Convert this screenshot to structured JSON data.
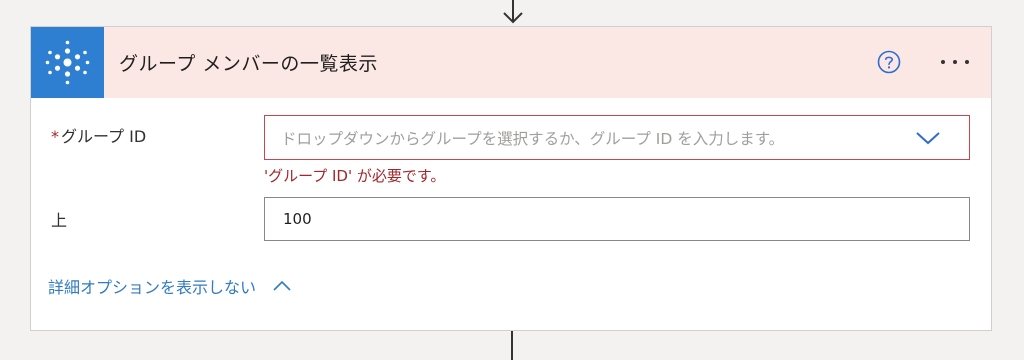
{
  "card": {
    "title": "グループ メンバーの一覧表示",
    "icon": "office365-groups-icon",
    "header_color": "#fbe8e4",
    "icon_bg_color": "#2e7fd1"
  },
  "fields": {
    "group_id": {
      "required_marker": "*",
      "label": "グループ ID",
      "placeholder": "ドロップダウンからグループを選択するか、グループ ID を入力します。",
      "error": "'グループ ID' が必要です。",
      "error_color": "#a4262c"
    },
    "top": {
      "label": "上",
      "value": "100"
    }
  },
  "advanced_options": {
    "label": "詳細オプションを表示しない",
    "link_color": "#2f7bc4"
  },
  "icons": {
    "help": "help-circle-icon",
    "more": "more-horizontal-icon",
    "arrow": "arrow-down-icon",
    "dropdown": "chevron-down-icon",
    "collapse": "chevron-up-icon"
  }
}
